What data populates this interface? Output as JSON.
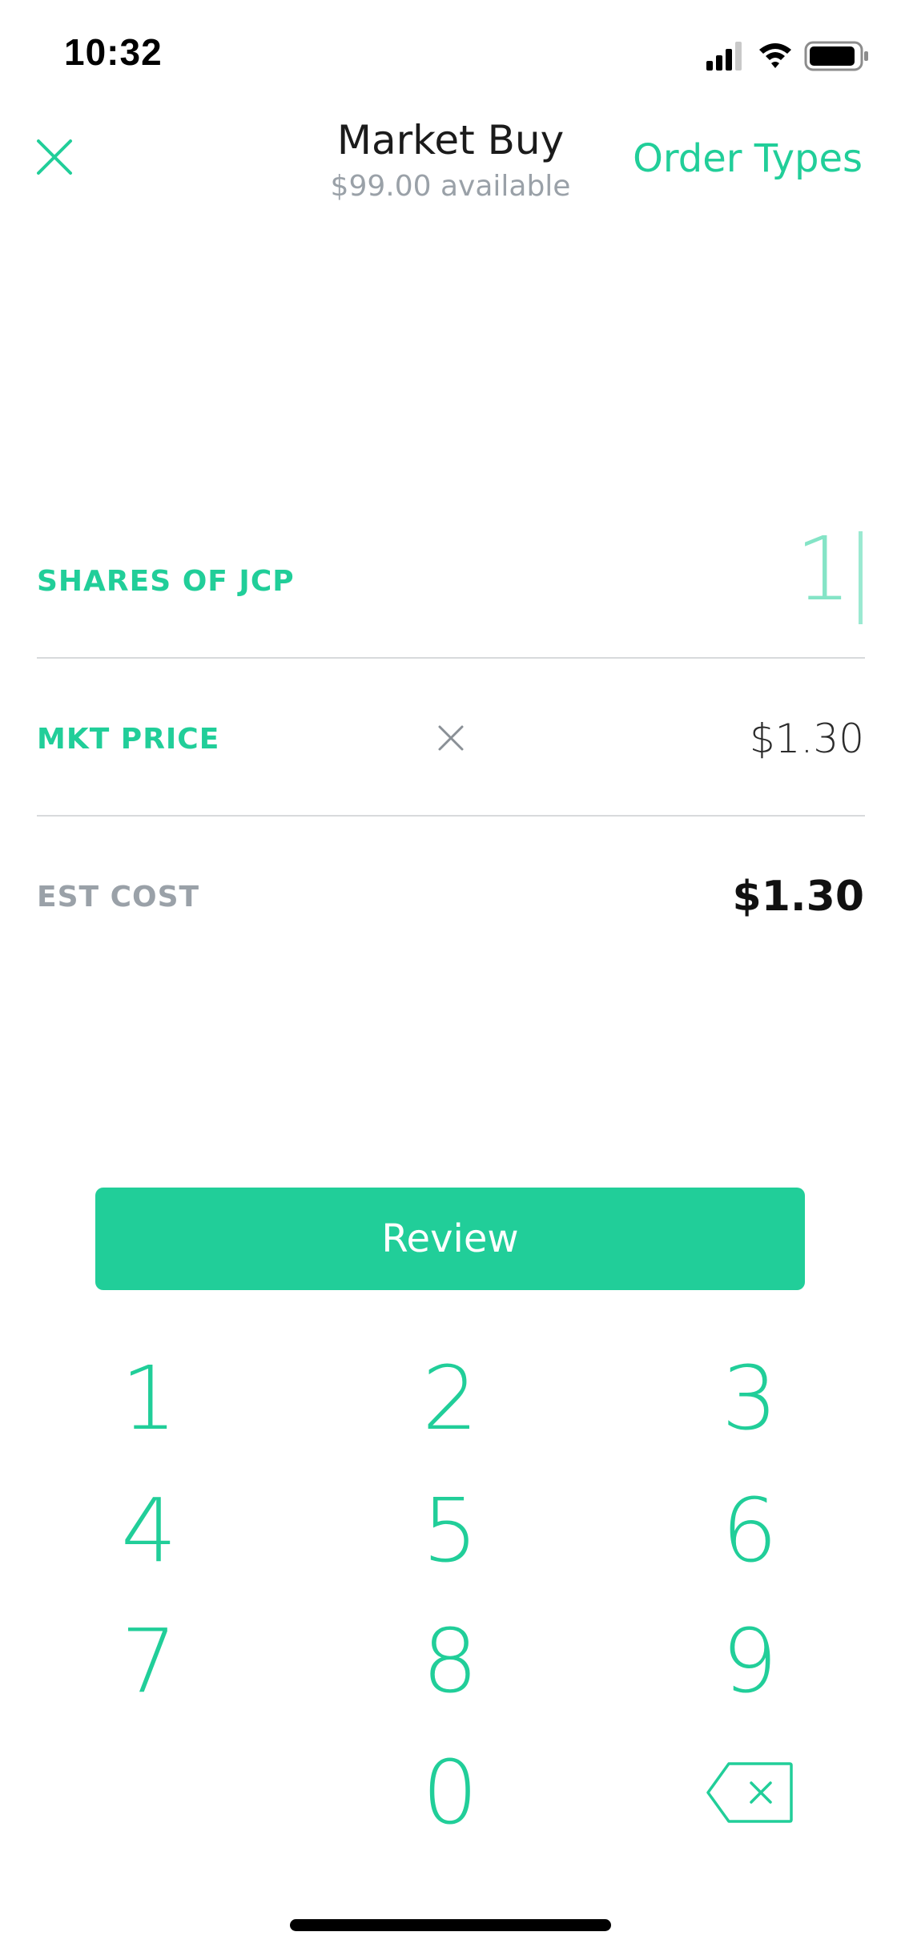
{
  "status_bar": {
    "time": "10:32"
  },
  "header": {
    "title": "Market Buy",
    "subtitle": "$99.00 available",
    "order_types_label": "Order Types"
  },
  "order": {
    "shares_label": "SHARES OF JCP",
    "shares_value": "1",
    "market_price_label": "MKT PRICE",
    "market_price_value": "$1.30",
    "est_cost_label": "EST COST",
    "est_cost_value": "$1.30"
  },
  "review_button": "Review",
  "keypad": {
    "keys": [
      "1",
      "2",
      "3",
      "4",
      "5",
      "6",
      "7",
      "8",
      "9",
      "0"
    ]
  },
  "colors": {
    "accent": "#21ce99",
    "muted": "#9aa1a8",
    "divider": "#d8dadc"
  },
  "icons": [
    "close-icon",
    "clear-icon",
    "backspace-icon",
    "cellular-signal-icon",
    "wifi-icon",
    "battery-icon"
  ]
}
